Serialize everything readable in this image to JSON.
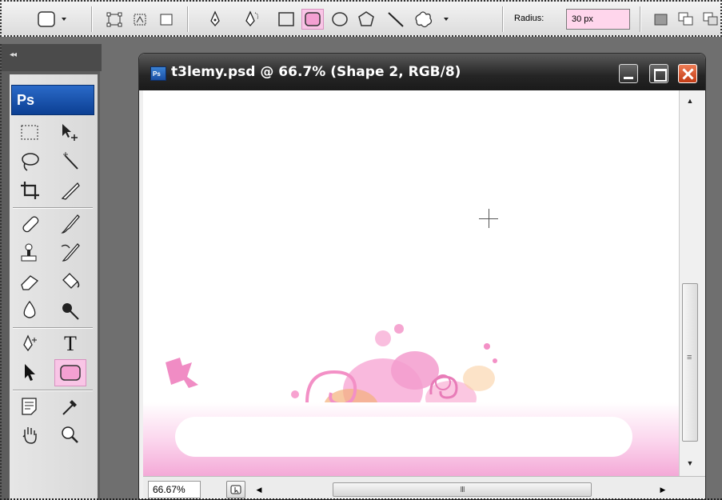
{
  "options_bar": {
    "radius_label": "Radius:",
    "radius_value": "30 px",
    "dropdown_arrow": "▼",
    "tools": [
      "tool-preset-picker",
      "shape-layers",
      "paths",
      "fill-pixels",
      "pen",
      "freeform-pen",
      "rectangle",
      "rounded-rectangle",
      "ellipse",
      "polygon",
      "line",
      "custom-shape"
    ],
    "active_tool": "rounded-rectangle",
    "active_color": "#f9c5e6"
  },
  "tools_panel": {
    "collapse_label": "◂◂",
    "logo_text": "Ps",
    "type_tool_label": "T"
  },
  "document": {
    "title": "t3lemy.psd @ 66.7% (Shape 2, RGB/8)",
    "icon_text": "Ps",
    "zoom": "66.67%",
    "hscroll_grip": "III",
    "vscroll_grip": "≡",
    "canvas_background": "#ffffff",
    "banner_color": "#f4a9d7"
  }
}
